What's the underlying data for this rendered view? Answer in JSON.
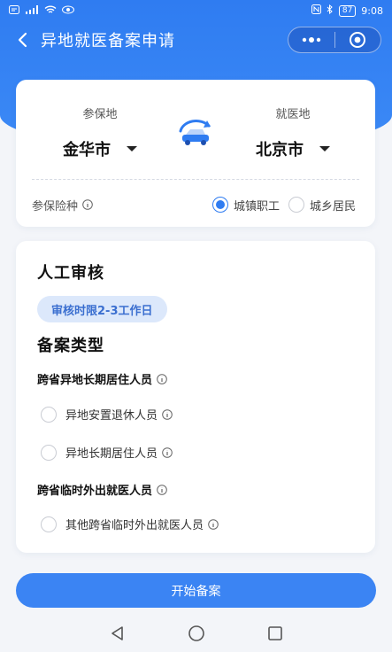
{
  "status_bar": {
    "battery": "87",
    "time": "9:08"
  },
  "header": {
    "title": "异地就医备案申请"
  },
  "location_card": {
    "insured_label": "参保地",
    "insured_value": "金华市",
    "medical_label": "就医地",
    "medical_value": "北京市",
    "insurance_type_label": "参保险种",
    "insurance_options": [
      {
        "label": "城镇职工",
        "selected": true
      },
      {
        "label": "城乡居民",
        "selected": false
      }
    ]
  },
  "review_card": {
    "title": "人工审核",
    "badge": "审核时限2-3工作日",
    "type_title": "备案类型",
    "groups": [
      {
        "title": "跨省异地长期居住人员",
        "options": [
          "异地安置退休人员",
          "异地长期居住人员"
        ]
      },
      {
        "title": "跨省临时外出就医人员",
        "options": [
          "其他跨省临时外出就医人员"
        ]
      }
    ]
  },
  "start_button": "开始备案",
  "colors": {
    "primary": "#2f7cf1",
    "badge_bg": "#dce8fb"
  }
}
